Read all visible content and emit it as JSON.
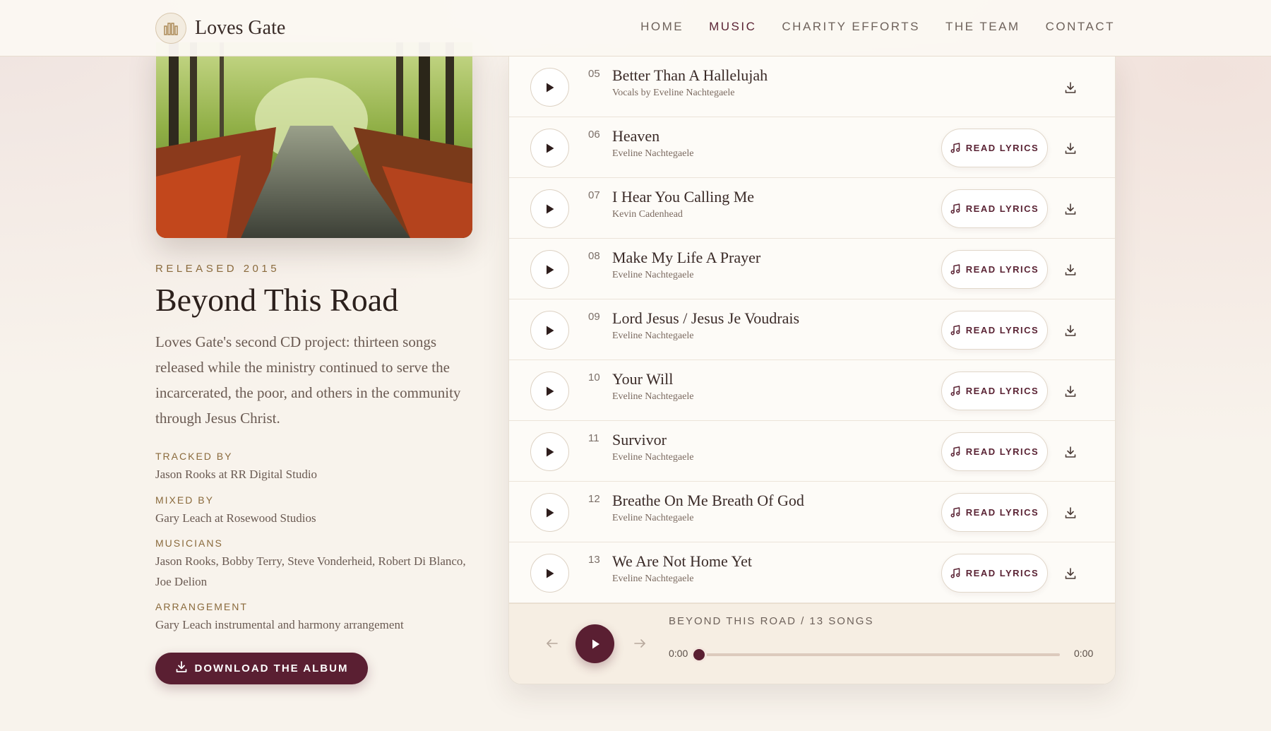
{
  "brand": {
    "name": "Loves Gate",
    "logo_icon": "organ-pipes-icon"
  },
  "nav": {
    "items": [
      {
        "label": "HOME",
        "active": false
      },
      {
        "label": "MUSIC",
        "active": true
      },
      {
        "label": "CHARITY EFFORTS",
        "active": false
      },
      {
        "label": "THE TEAM",
        "active": false
      },
      {
        "label": "CONTACT",
        "active": false
      }
    ]
  },
  "album": {
    "release": "RELEASED 2015",
    "title": "Beyond This Road",
    "description": "Loves Gate's second CD project: thirteen songs released while the ministry continued to serve the incarcerated, the poor, and others in the community through Jesus Christ.",
    "cover_alt": "Autumn forest road",
    "credits": [
      {
        "label": "TRACKED BY",
        "value": "Jason Rooks at RR Digital Studio"
      },
      {
        "label": "MIXED BY",
        "value": "Gary Leach at Rosewood Studios"
      },
      {
        "label": "MUSICIANS",
        "value": "Jason Rooks, Bobby Terry, Steve Vonderheid, Robert Di Blanco, Joe Delion"
      },
      {
        "label": "ARRANGEMENT",
        "value": "Gary Leach instrumental and harmony arrangement"
      }
    ],
    "download_label": "DOWNLOAD THE ALBUM"
  },
  "tracks": [
    {
      "num": "05",
      "title": "Better Than A Hallelujah",
      "artist": "Vocals by Eveline Nachtegaele",
      "lyrics": false
    },
    {
      "num": "06",
      "title": "Heaven",
      "artist": "Eveline Nachtegaele",
      "lyrics": true
    },
    {
      "num": "07",
      "title": "I Hear You Calling Me",
      "artist": "Kevin Cadenhead",
      "lyrics": true
    },
    {
      "num": "08",
      "title": "Make My Life A Prayer",
      "artist": "Eveline Nachtegaele",
      "lyrics": true
    },
    {
      "num": "09",
      "title": "Lord Jesus / Jesus Je Voudrais",
      "artist": "Eveline Nachtegaele",
      "lyrics": true
    },
    {
      "num": "10",
      "title": "Your Will",
      "artist": "Eveline Nachtegaele",
      "lyrics": true
    },
    {
      "num": "11",
      "title": "Survivor",
      "artist": "Eveline Nachtegaele",
      "lyrics": true
    },
    {
      "num": "12",
      "title": "Breathe On Me Breath Of God",
      "artist": "Eveline Nachtegaele",
      "lyrics": true
    },
    {
      "num": "13",
      "title": "We Are Not Home Yet",
      "artist": "Eveline Nachtegaele",
      "lyrics": true
    }
  ],
  "lyrics_label": "READ LYRICS",
  "player": {
    "caption": "BEYOND THIS ROAD / 13 SONGS",
    "time_current": "0:00",
    "time_total": "0:00",
    "progress": 0
  },
  "colors": {
    "accent": "#5a1f32",
    "gold": "#8a6a3c",
    "background": "#f8f3ec"
  }
}
